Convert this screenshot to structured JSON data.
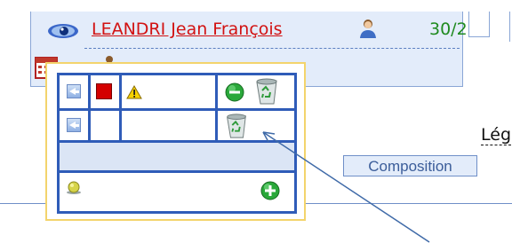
{
  "patient": {
    "name": "LEANDRI Jean François",
    "bed": "30/2"
  },
  "legend_label": "Lég",
  "composition_label": "Composition",
  "icons": {
    "eye": "eye-icon",
    "person": "person-icon",
    "calendar": "calendar-icon",
    "arrow_left": "arrow-left-icon",
    "red_square": "red-square-icon",
    "warning": "warning-icon",
    "minus": "minus-circle-icon",
    "trash": "recycle-bin-icon",
    "pin": "yellow-pin-icon",
    "plus": "plus-circle-icon"
  },
  "colors": {
    "patient_name": "#d21212",
    "bed_number": "#1f8a1f",
    "popup_border": "#f3d46c",
    "grid_border": "#2f5cb8"
  }
}
